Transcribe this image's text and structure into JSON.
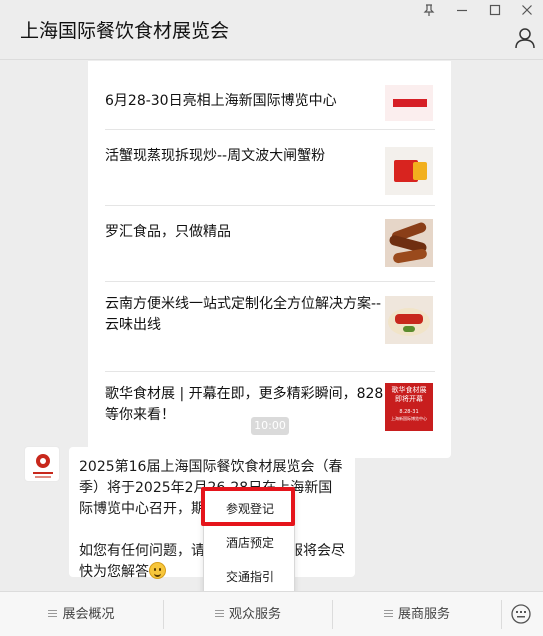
{
  "window": {
    "title": "上海国际餐饮食材展览会"
  },
  "articles": [
    {
      "title": "6月28-30日亮相上海新国际博览中心"
    },
    {
      "title": "活蟹现蒸现拆现炒--周文波大闸蟹粉"
    },
    {
      "title": "罗汇食品，只做精品"
    },
    {
      "title": "云南方便米线一站式定制化全方位解决方案--云味出线"
    },
    {
      "title": "歌华食材展 | 开幕在即，更多精彩瞬间，828等你来看！"
    }
  ],
  "thumb_texts": {
    "gehua_top": "歌华食材展",
    "gehua_mid": "即将开幕",
    "gehua_date": "8.28-31",
    "gehua_place": "上海新国际博览中心"
  },
  "time_badge": "10:00",
  "message": {
    "text": "2025第16届上海国际餐饮食材展览会（春季）将于2025年2月26-28日在上海新国际博览中心召开，期待您的光临！\n\n如您有任何问题，请在此留言，客服将会尽快为您解答"
  },
  "popup_menu": {
    "items": [
      "参观登记",
      "酒店预定",
      "交通指引"
    ]
  },
  "bottom_menu": {
    "items": [
      "展会概况",
      "观众服务",
      "展商服务"
    ]
  },
  "colors": {
    "highlight": "#e5141b",
    "background": "#ededed"
  }
}
